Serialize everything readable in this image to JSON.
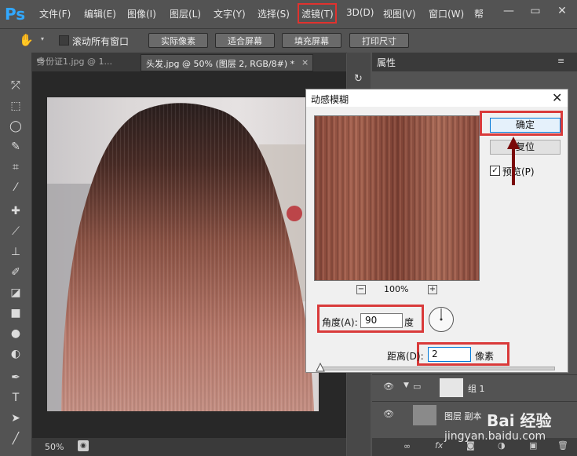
{
  "menubar": {
    "logo": "Ps",
    "items": [
      "文件(F)",
      "编辑(E)",
      "图像(I)",
      "图层(L)",
      "文字(Y)",
      "选择(S)",
      "滤镜(T)",
      "3D(D)",
      "视图(V)",
      "窗口(W)",
      "帮"
    ],
    "window_controls": [
      "—",
      "▭",
      "✕"
    ]
  },
  "options": {
    "scroll_all_label": "滚动所有窗口",
    "buttons": [
      "实际像素",
      "适合屏幕",
      "填充屏幕",
      "打印尺寸"
    ]
  },
  "tabs": [
    {
      "label": "身份证1.jpg @ 1...",
      "close": "×"
    },
    {
      "label": "头发.jpg @ 50% (图层 2, RGB/8#) *",
      "close": "×"
    }
  ],
  "status": {
    "zoom": "50%"
  },
  "panel": {
    "title": "属性"
  },
  "layers": [
    {
      "name": "组 1"
    },
    {
      "name": "图层 副本"
    }
  ],
  "dialog": {
    "title": "动感模糊",
    "ok_label": "确定",
    "reset_label": "复位",
    "preview_label": "预览(P)",
    "preview_checked": true,
    "zoom_label": "100%",
    "zoom_minus": "−",
    "zoom_plus": "+",
    "angle_label": "角度(A):",
    "angle_value": "90",
    "angle_unit": "度",
    "distance_label": "距离(D):",
    "distance_value": "2",
    "distance_unit": "像素"
  },
  "watermark": {
    "brand": "Bai 经验",
    "url": "jingyan.baidu.com"
  },
  "colors": {
    "highlight_red": "#d93a3a",
    "arrow_dark_red": "#7a0a0a",
    "ps_blue": "#31a8ff"
  }
}
